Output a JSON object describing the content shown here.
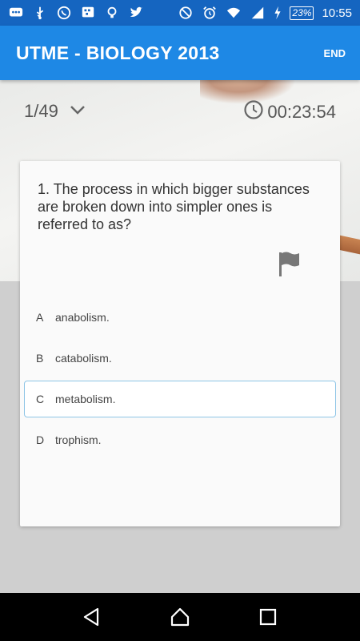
{
  "status_bar": {
    "battery": "23%",
    "time": "10:55"
  },
  "app_bar": {
    "title": "UTME - BIOLOGY 2013",
    "end_label": "END"
  },
  "header": {
    "counter": "1/49",
    "timer": "00:23:54"
  },
  "question": {
    "text": "1. The process in which bigger substances are broken down into simpler ones is referred to as?",
    "options": [
      {
        "letter": "A",
        "text": "anabolism."
      },
      {
        "letter": "B",
        "text": "catabolism."
      },
      {
        "letter": "C",
        "text": "metabolism."
      },
      {
        "letter": "D",
        "text": "trophism."
      }
    ],
    "selected_letter": "C"
  },
  "colors": {
    "status_bar": "#1565c0",
    "app_bar": "#1e88e5",
    "selected_border": "#8ec5e6"
  }
}
